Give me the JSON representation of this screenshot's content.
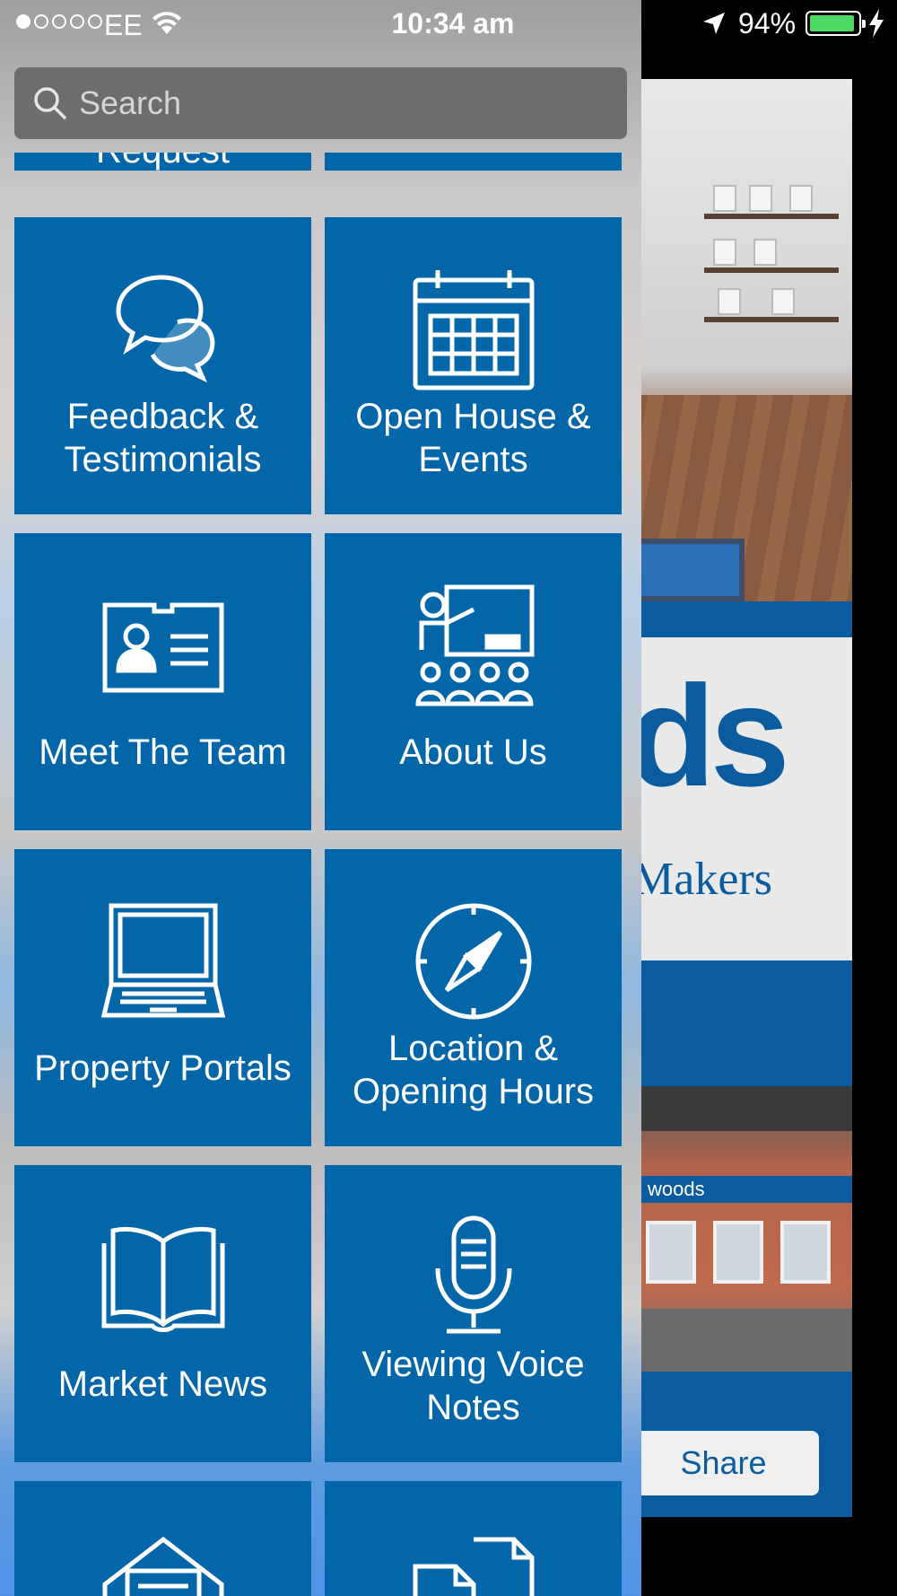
{
  "status_bar": {
    "carrier": "EE",
    "time": "10:34 am",
    "battery_percent": "94%",
    "battery_level": 0.94,
    "signal_bars": 1,
    "signal_total": 5
  },
  "search": {
    "placeholder": "Search"
  },
  "menu": {
    "partial_top": [
      {
        "label": "Request"
      },
      {
        "label": ""
      }
    ],
    "tiles": [
      {
        "label": "Feedback &\nTestimonials",
        "icon": "chat-bubbles-icon"
      },
      {
        "label": "Open House &\nEvents",
        "icon": "calendar-icon"
      },
      {
        "label": "Meet The Team",
        "icon": "id-card-icon"
      },
      {
        "label": "About Us",
        "icon": "presentation-icon"
      },
      {
        "label": "Property Portals",
        "icon": "laptop-icon"
      },
      {
        "label": "Location &\nOpening Hours",
        "icon": "compass-icon"
      },
      {
        "label": "Market News",
        "icon": "open-book-icon"
      },
      {
        "label": "Viewing Voice\nNotes",
        "icon": "microphone-icon"
      }
    ],
    "partial_bottom": [
      {
        "icon": "envelope-icon"
      },
      {
        "icon": "documents-icon"
      }
    ]
  },
  "background_app": {
    "logo_text": "ds",
    "logo_subtitle": "Makers",
    "sign_text": "woods",
    "share_label": "Share"
  },
  "colors": {
    "tile_blue": "#0366a8",
    "brand_blue": "#0a5c9e",
    "battery_green": "#4cd964"
  }
}
